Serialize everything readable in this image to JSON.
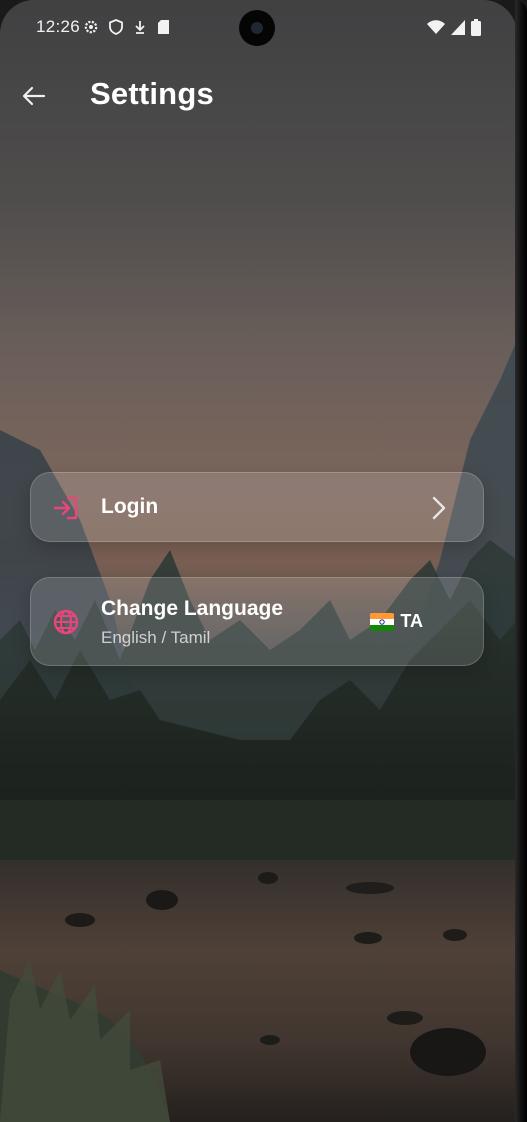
{
  "status_bar": {
    "time": "12:26",
    "left_icons": [
      "gear-icon",
      "shield-icon",
      "download-icon",
      "sd-card-icon"
    ],
    "right_icons": [
      "wifi-icon",
      "signal-icon",
      "battery-icon"
    ]
  },
  "app_bar": {
    "back_icon": "arrow-left-icon",
    "title": "Settings"
  },
  "settings": {
    "login": {
      "label": "Login",
      "icon": "login-icon",
      "trailing_icon": "chevron-right-icon"
    },
    "language": {
      "label": "Change Language",
      "subtitle": "English / Tamil",
      "icon": "globe-icon",
      "flag": "india-flag-icon",
      "current_code": "TA"
    }
  },
  "colors": {
    "accent": "#e8457b",
    "card_background": "rgba(255,255,255,0.14)",
    "text_primary": "#ffffff"
  }
}
